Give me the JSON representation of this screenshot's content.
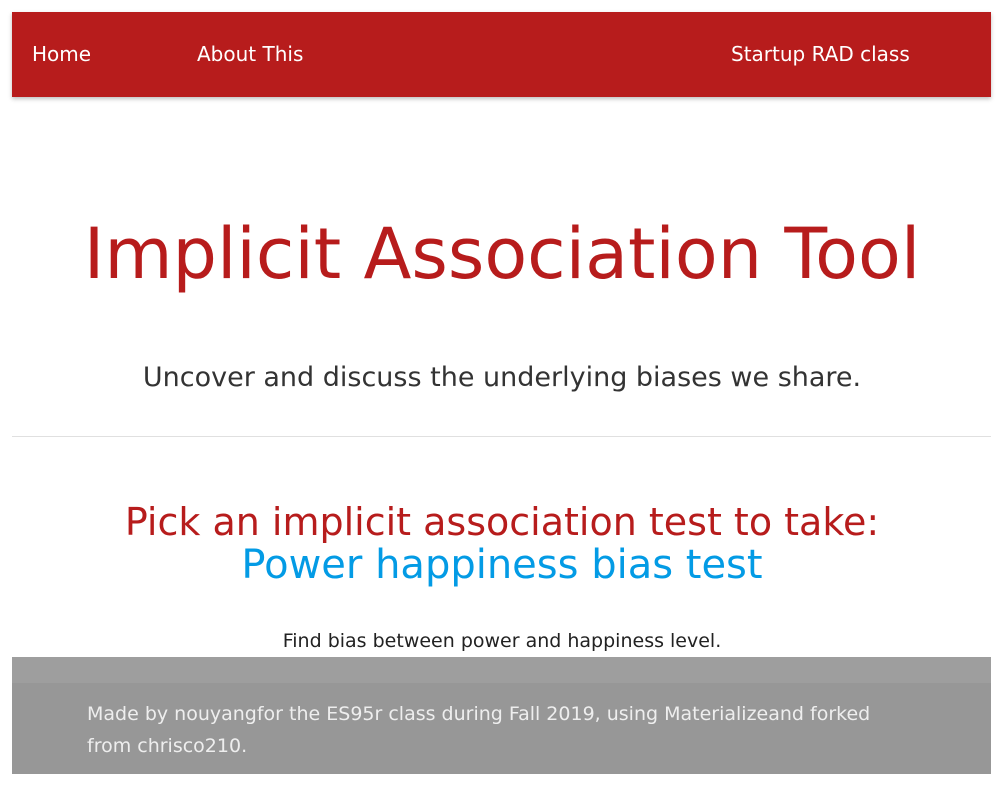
{
  "nav": {
    "home_label": "Home",
    "about_label": "About This",
    "startup_label": "Startup RAD class"
  },
  "hero": {
    "title": "Implicit Association Tool",
    "subtitle": "Uncover and discuss the underlying biases we share."
  },
  "tests": {
    "heading": "Pick an implicit association test to take:",
    "items": [
      {
        "title": "Power happiness bias test",
        "description": "Find bias between power and happiness level."
      }
    ]
  },
  "footer": {
    "text": "Made by nouyangfor the ES95r class during Fall 2019, using Materializeand forked from chrisco210."
  },
  "colors": {
    "primary": "#b71c1c",
    "link": "#039be5",
    "footer": "#9e9e9e"
  }
}
